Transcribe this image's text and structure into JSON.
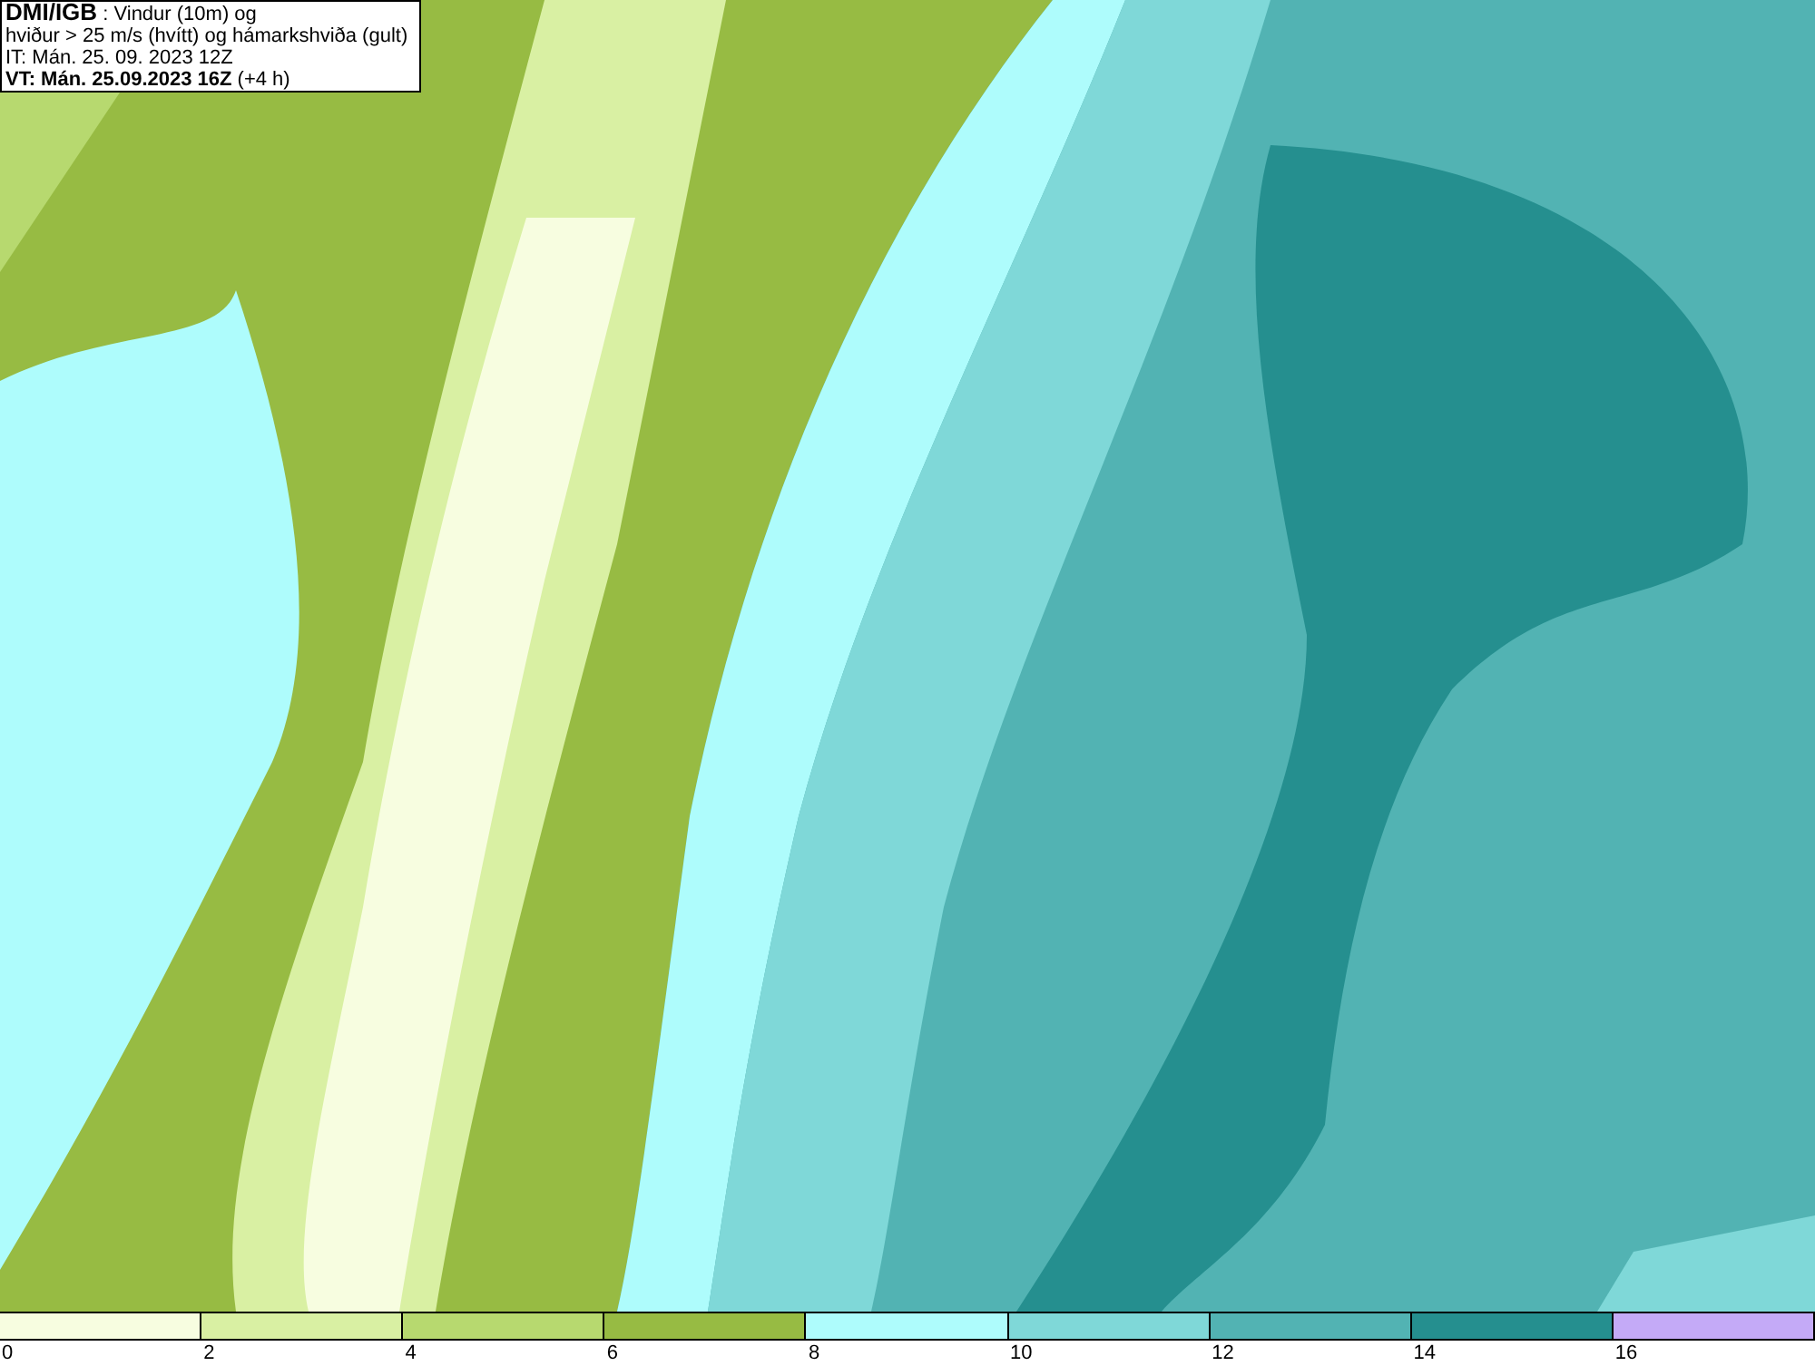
{
  "header": {
    "source": "DMI/IGB",
    "title_rest": " : Vindur (10m) og",
    "line_2": "hviður > 25 m/s (hvítt) og hámarkshviða (gult)",
    "line_3": "IT: Mán. 25. 09. 2023 12Z",
    "valid_bold": "VT: Mán. 25.09.2023 16Z",
    "valid_rest": " (+4 h)"
  },
  "legend": [
    {
      "label": "0",
      "color": "#f7fde0"
    },
    {
      "label": "2",
      "color": "#d9f0a3"
    },
    {
      "label": "4",
      "color": "#b7d96f"
    },
    {
      "label": "6",
      "color": "#97bb43"
    },
    {
      "label": "8",
      "color": "#aefcfc"
    },
    {
      "label": "10",
      "color": "#7fd8d8"
    },
    {
      "label": "12",
      "color": "#52b3b3"
    },
    {
      "label": "14",
      "color": "#258f8f"
    },
    {
      "label": "16",
      "color": "#c4aaf7"
    }
  ]
}
